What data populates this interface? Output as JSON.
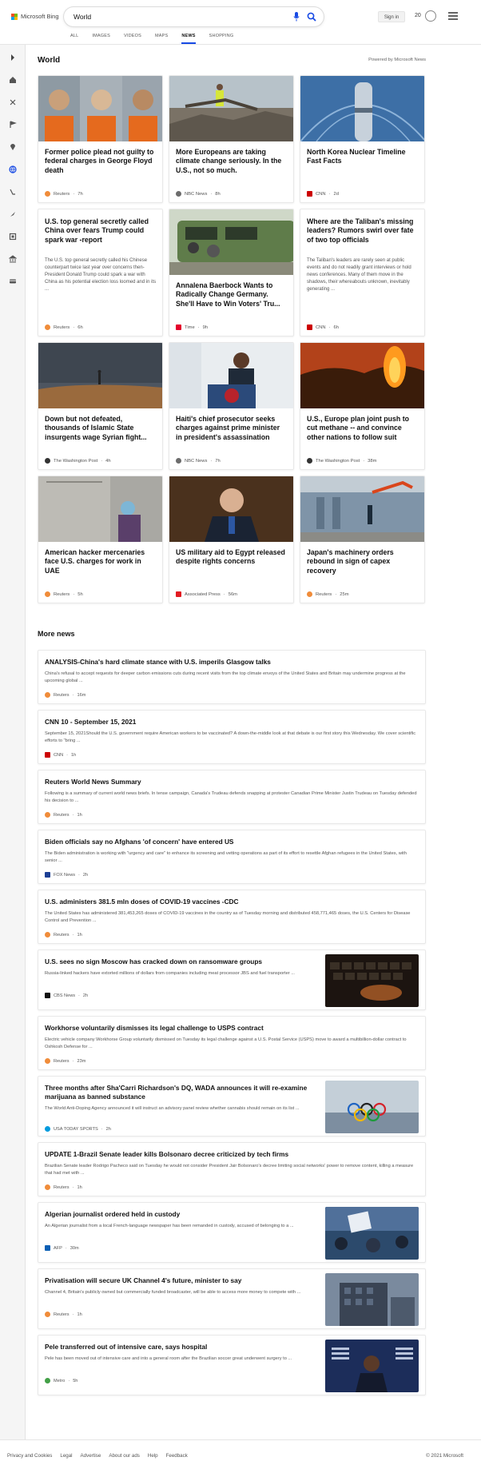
{
  "header": {
    "logo_text": "Microsoft Bing",
    "search_value": "World",
    "sign_in": "Sign in",
    "points": "20"
  },
  "tabs": [
    {
      "label": "ALL"
    },
    {
      "label": "IMAGES"
    },
    {
      "label": "VIDEOS"
    },
    {
      "label": "MAPS"
    },
    {
      "label": "NEWS",
      "active": true
    },
    {
      "label": "SHOPPING"
    }
  ],
  "section": {
    "title": "World",
    "powered_by": "Powered by Microsoft News"
  },
  "top_cards": [
    {
      "title": "Former police plead not guilty to federal charges in George Floyd death",
      "source": "Reuters",
      "time": "7h",
      "source_color": "#f08c3a",
      "image": "mugshots"
    },
    {
      "title": "More Europeans are taking climate change seriously. In the U.S., not so much.",
      "source": "NBC News",
      "time": "8h",
      "source_color": "#6c6c6c",
      "image": "flood-debris"
    },
    {
      "title": "North Korea Nuclear Timeline Fast Facts",
      "source": "CNN",
      "time": "2d",
      "source_color": "#cc0000",
      "image": "missile-dome"
    },
    {
      "title": "U.S. top general secretly called China over fears Trump could spark war -report",
      "snippet": "The U.S. top general secretly called his Chinese counterpart twice last year over concerns then-President Donald Trump could spark a war with China as his potential election loss loomed and in its ...",
      "source": "Reuters",
      "time": "6h",
      "source_color": "#f08c3a",
      "image": ""
    },
    {
      "title": "Annalena Baerbock Wants to Radically Change Germany. She'll Have to Win Voters' Tru...",
      "source": "Time",
      "time": "9h",
      "source_color": "#e4002b",
      "image": "campaign-bus"
    },
    {
      "title": "Where are the Taliban's missing leaders? Rumors swirl over fate of two top officials",
      "snippet": "The Taliban's leaders are rarely seen at public events and do not readily grant interviews or hold news conferences. Many of them move in the shadows, their whereabouts unknown, inevitably generating ...",
      "source": "CNN",
      "time": "6h",
      "source_color": "#cc0000",
      "image": ""
    },
    {
      "title": "Down but not defeated, thousands of Islamic State insurgents wage Syrian fight...",
      "source": "The Washington Post",
      "time": "4h",
      "source_color": "#333333",
      "image": "desert-figure"
    },
    {
      "title": "Haiti's chief prosecutor seeks charges against prime minister in president's assassination",
      "source": "NBC News",
      "time": "7h",
      "source_color": "#6c6c6c",
      "image": "podium"
    },
    {
      "title": "U.S., Europe plan joint push to cut methane -- and convince other nations to follow suit",
      "source": "The Washington Post",
      "time": "38m",
      "source_color": "#333333",
      "image": "gas-flare"
    },
    {
      "title": "American hacker mercenaries face U.S. charges for work in UAE",
      "source": "Reuters",
      "time": "5h",
      "source_color": "#f08c3a",
      "image": "justice"
    },
    {
      "title": "US military aid to Egypt released despite rights concerns",
      "source": "Associated Press",
      "time": "56m",
      "source_color": "#e21b22",
      "image": "official"
    },
    {
      "title": "Japan's machinery orders rebound in sign of capex recovery",
      "source": "Reuters",
      "time": "25m",
      "source_color": "#f08c3a",
      "image": "excavator"
    }
  ],
  "more_news": {
    "title": "More news",
    "items": [
      {
        "title": "ANALYSIS-China's hard climate stance with U.S. imperils Glasgow talks",
        "snippet": "China's refusal to accept requests for deeper carbon emissions cuts during recent visits from the top climate envoys of the United States and Britain may undermine progress at the upcoming global ...",
        "source": "Reuters",
        "time": "16m",
        "source_color": "#f08c3a",
        "thumb": ""
      },
      {
        "title": "CNN 10 - September 15, 2021",
        "snippet": "September 15, 2021Should the U.S. government require American workers to be vaccinated? A down-the-middle look at that debate is our first story this Wednesday. We cover scientific efforts to \"bring ...",
        "source": "CNN",
        "time": "1h",
        "source_color": "#cc0000",
        "thumb": ""
      },
      {
        "title": "Reuters World News Summary",
        "snippet": "Following is a summary of current world news briefs. In tense campaign, Canada's Trudeau defends snapping at protester Canadian Prime Minister Justin Trudeau on Tuesday defended his decision to ...",
        "source": "Reuters",
        "time": "1h",
        "source_color": "#f08c3a",
        "thumb": ""
      },
      {
        "title": "Biden officials say no Afghans 'of concern' have entered US",
        "snippet": "The Biden administration is working with \"urgency and care\" to enhance its screening and vetting operations as part of its effort to resettle Afghan refugees in the United States, with senior ...",
        "source": "FOX News",
        "time": "2h",
        "source_color": "#1c3f94",
        "thumb": ""
      },
      {
        "title": "U.S. administers 381.5 mln doses of COVID-19 vaccines -CDC",
        "snippet": "The United States has administered 381,453,265 doses of COVID-19 vaccines in the country as of Tuesday morning and distributed 458,771,465 doses, the U.S. Centers for Disease Control and Prevention ...",
        "source": "Reuters",
        "time": "1h",
        "source_color": "#f08c3a",
        "thumb": ""
      },
      {
        "title": "U.S. sees no sign Moscow has cracked down on ransomware groups",
        "snippet": "Russia-linked hackers have extorted millions of dollars from companies including meat processor JBS and fuel transporter ...",
        "source": "CBS News",
        "time": "2h",
        "source_color": "#111111",
        "thumb": "keyboard"
      },
      {
        "title": "Workhorse voluntarily dismisses its legal challenge to USPS contract",
        "snippet": "Electric vehicle company Workhorse Group voluntarily dismissed on Tuesday its legal challenge against a U.S. Postal Service (USPS) move to award a multibillion-dollar contract to Oshkosh Defense for ...",
        "source": "Reuters",
        "time": "23m",
        "source_color": "#f08c3a",
        "thumb": ""
      },
      {
        "title": "Three months after Sha'Carri Richardson's DQ, WADA announces it will re-examine marijuana as banned substance",
        "snippet": "The World Anti-Doping Agency announced it will instruct an advisory panel review whether cannabis should remain on its list ...",
        "source": "USA TODAY SPORTS",
        "time": "2h",
        "source_color": "#009bde",
        "thumb": "olympic-rings"
      },
      {
        "title": "UPDATE 1-Brazil Senate leader kills Bolsonaro decree criticized by tech firms",
        "snippet": "Brazilian Senate leader Rodrigo Pacheco said on Tuesday he would not consider President Jair Bolsonaro's decree limiting social networks' power to remove content, killing a measure that had met with ...",
        "source": "Reuters",
        "time": "1h",
        "source_color": "#f08c3a",
        "thumb": ""
      },
      {
        "title": "Algerian journalist ordered held in custody",
        "snippet": "An Algerian journalist from a local French-language newspaper has been remanded in custody, accused of belonging to a ...",
        "source": "AFP",
        "time": "30m",
        "source_color": "#0a5fb4",
        "thumb": "protest"
      },
      {
        "title": "Privatisation will secure UK Channel 4's future, minister to say",
        "snippet": "Channel 4, Britain's publicly owned but commercially funded broadcaster, will be able to access more money to compete with ...",
        "source": "Reuters",
        "time": "1h",
        "source_color": "#f08c3a",
        "thumb": "building"
      },
      {
        "title": "Pele transferred out of intensive care, says hospital",
        "snippet": "Pele has been moved out of intensive care and into a general room after the Brazilian soccer great underwent surgery to ...",
        "source": "Metro",
        "time": "5h",
        "source_color": "#43a047",
        "thumb": "forum"
      }
    ]
  },
  "footer": {
    "links": [
      "Privacy and Cookies",
      "Legal",
      "Advertise",
      "About our ads",
      "Help",
      "Feedback"
    ],
    "copyright": "© 2021 Microsoft"
  }
}
